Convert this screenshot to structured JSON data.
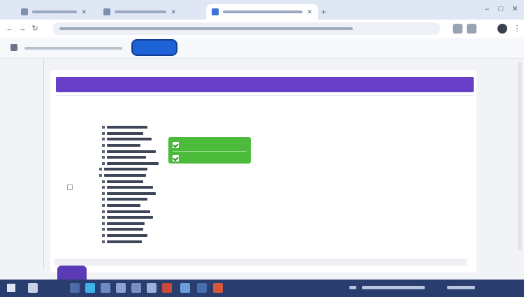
{
  "browser": {
    "tabs": [
      {
        "label": "",
        "favicon": "app-icon"
      },
      {
        "label": "",
        "favicon": "app-icon"
      },
      {
        "label": "",
        "favicon": "globe-icon",
        "active": true
      }
    ],
    "new_tab_label": "+",
    "address": {
      "url": ""
    },
    "toolbar": {
      "path": "",
      "action_button_label": ""
    }
  },
  "page": {
    "header_title": "",
    "section_title": "",
    "tree_items": [
      "",
      "",
      "",
      "",
      "",
      "",
      "",
      "",
      "",
      "",
      "",
      "",
      "",
      "",
      "",
      "",
      "",
      "",
      "",
      ""
    ],
    "badges": [
      {
        "label": "",
        "checked": true
      },
      {
        "label": "",
        "checked": true
      }
    ],
    "fab_label": ""
  },
  "taskbar": {
    "time": "",
    "date": ""
  },
  "colors": {
    "header": "#6a3fc8",
    "badge": "#4cbb3c",
    "primary_button": "#1d62d6",
    "taskbar": "#2a3d6f"
  }
}
